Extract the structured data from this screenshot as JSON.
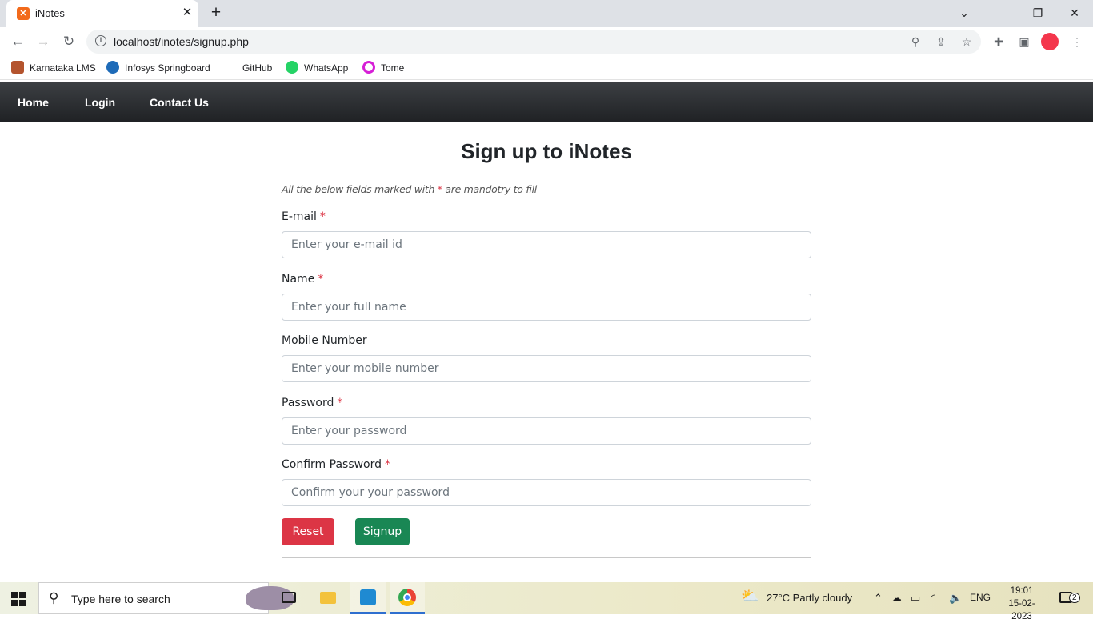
{
  "browser": {
    "tab_title": "iNotes",
    "tab_close": "✕",
    "new_tab": "+",
    "url": "localhost/inotes/signup.php",
    "window_controls": {
      "minimize": "—",
      "restore": "❐",
      "close": "✕"
    },
    "bookmarks": [
      {
        "label": "Karnataka LMS",
        "color": "#b4542e"
      },
      {
        "label": "Infosys Springboard",
        "color": "#1e6bb8"
      },
      {
        "label": "GitHub",
        "color": ""
      },
      {
        "label": "WhatsApp",
        "color": "#25d366"
      },
      {
        "label": "Tome",
        "color": "#d61fd6"
      }
    ]
  },
  "navbar": {
    "links": [
      "Home",
      "Login",
      "Contact Us"
    ]
  },
  "form": {
    "title": "Sign up to iNotes",
    "note_before": "All the below fields marked with ",
    "note_star": "*",
    "note_after": " are mandotry to fill",
    "required_mark": "*",
    "fields": [
      {
        "label": "E-mail",
        "placeholder": "Enter your e-mail id",
        "required": true
      },
      {
        "label": "Name",
        "placeholder": "Enter your full name",
        "required": true
      },
      {
        "label": "Mobile Number",
        "placeholder": "Enter your mobile number",
        "required": false
      },
      {
        "label": "Password",
        "placeholder": "Enter your password",
        "required": true
      },
      {
        "label": "Confirm Password",
        "placeholder": "Confirm your your password",
        "required": true
      }
    ],
    "reset_label": "Reset",
    "signup_label": "Signup",
    "reset_color": "#dc3545",
    "signup_color": "#198754"
  },
  "taskbar": {
    "search_placeholder": "Type here to search",
    "weather": "27°C  Partly cloudy",
    "language": "ENG",
    "time": "19:01",
    "date": "15-02-2023",
    "notifications": "2"
  }
}
